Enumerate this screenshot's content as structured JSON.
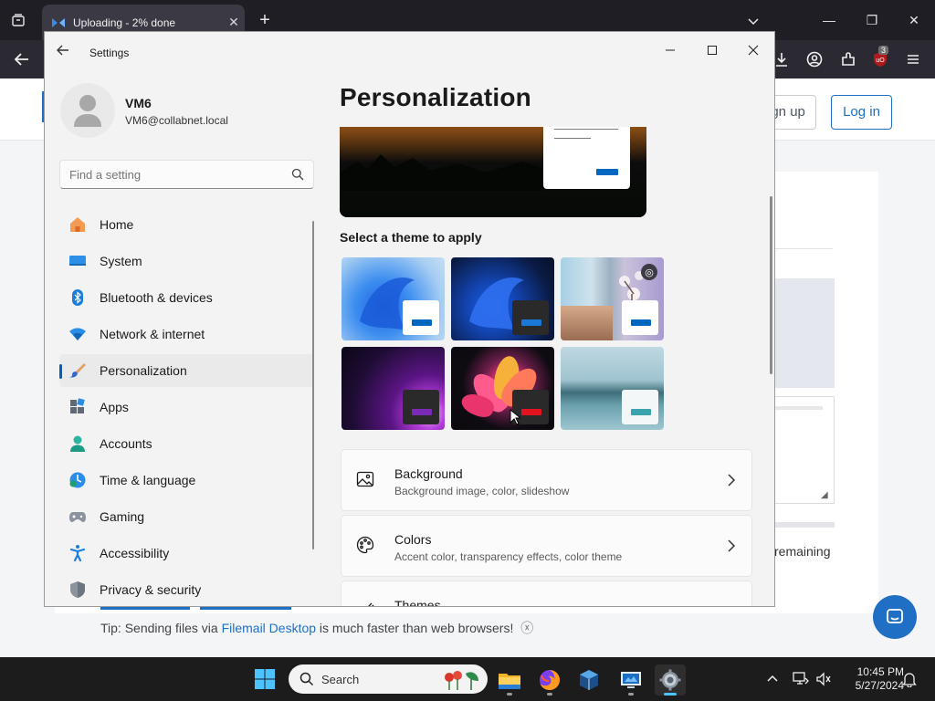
{
  "browser": {
    "tab_title": "Uploading - 2% done",
    "extension_badge": "3"
  },
  "website": {
    "signup_label": "Sign up",
    "login_label": "Log in",
    "remaining_text": "remaining",
    "tip_prefix": "Tip: Sending files via ",
    "tip_link": "Filemail Desktop",
    "tip_suffix": " is much faster than web browsers!"
  },
  "settings": {
    "window_title": "Settings",
    "profile": {
      "name": "VM6",
      "email": "VM6@collabnet.local"
    },
    "search": {
      "placeholder": "Find a setting"
    },
    "nav": {
      "items": [
        {
          "label": "Home",
          "icon": "home-icon"
        },
        {
          "label": "System",
          "icon": "system-icon"
        },
        {
          "label": "Bluetooth & devices",
          "icon": "bluetooth-icon"
        },
        {
          "label": "Network & internet",
          "icon": "network-icon"
        },
        {
          "label": "Personalization",
          "icon": "personalization-icon",
          "active": true
        },
        {
          "label": "Apps",
          "icon": "apps-icon"
        },
        {
          "label": "Accounts",
          "icon": "accounts-icon"
        },
        {
          "label": "Time & language",
          "icon": "time-language-icon"
        },
        {
          "label": "Gaming",
          "icon": "gaming-icon"
        },
        {
          "label": "Accessibility",
          "icon": "accessibility-icon"
        },
        {
          "label": "Privacy & security",
          "icon": "privacy-icon"
        }
      ]
    },
    "page": {
      "title": "Personalization",
      "theme_heading": "Select a theme to apply",
      "themes": [
        {
          "name": "windows-light"
        },
        {
          "name": "windows-dark"
        },
        {
          "name": "windows-spotlight"
        },
        {
          "name": "glow"
        },
        {
          "name": "captured-motion"
        },
        {
          "name": "flow"
        }
      ],
      "cards": [
        {
          "title": "Background",
          "subtitle": "Background image, color, slideshow"
        },
        {
          "title": "Colors",
          "subtitle": "Accent color, transparency effects, color theme"
        },
        {
          "title": "Themes",
          "subtitle": ""
        }
      ]
    }
  },
  "taskbar": {
    "search_label": "Search",
    "time": "10:45 PM",
    "date": "5/27/2024"
  },
  "colors": {
    "accent": "#005fb8",
    "browser_chrome": "#1f1e25",
    "taskbar": "#1c1c1c",
    "website_link": "#1f6fc5"
  }
}
